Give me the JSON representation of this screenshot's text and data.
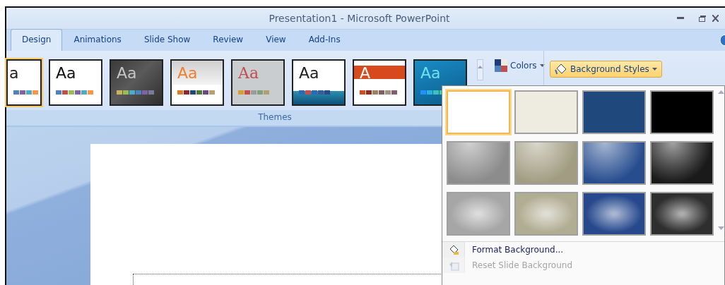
{
  "window": {
    "title": "Presentation1 - Microsoft PowerPoint"
  },
  "tabs": [
    {
      "label": "Design",
      "selected": true
    },
    {
      "label": "Animations",
      "selected": false
    },
    {
      "label": "Slide Show",
      "selected": false
    },
    {
      "label": "Review",
      "selected": false
    },
    {
      "label": "View",
      "selected": false
    },
    {
      "label": "Add-Ins",
      "selected": false
    }
  ],
  "themes": {
    "label": "Themes",
    "items": [
      {
        "kind": "office",
        "text": "a",
        "selected": true
      },
      {
        "kind": "plain",
        "text": "Aa",
        "selected": false
      },
      {
        "kind": "dark",
        "text": "Aa",
        "selected": false
      },
      {
        "kind": "orange",
        "text": "Aa",
        "selected": false
      },
      {
        "kind": "paper",
        "text": "Aa",
        "selected": false
      },
      {
        "kind": "wave",
        "text": "Aa",
        "selected": false
      },
      {
        "kind": "band",
        "text": "A",
        "selected": false
      },
      {
        "kind": "teal",
        "text": "Aa",
        "selected": false
      }
    ]
  },
  "colors_button": {
    "label": "Colors"
  },
  "background_styles_button": {
    "label": "Background Styles",
    "expanded": true
  },
  "background_styles": [
    {
      "kind": "solid",
      "color": "#ffffff",
      "selected": true
    },
    {
      "kind": "solid",
      "color": "#eeece1",
      "selected": false
    },
    {
      "kind": "solid",
      "color": "#1f497d",
      "selected": false
    },
    {
      "kind": "solid",
      "color": "#000000",
      "selected": false
    },
    {
      "kind": "gradient",
      "color": "#8c8c8c",
      "selected": false
    },
    {
      "kind": "gradient",
      "color": "#a29d82",
      "selected": false
    },
    {
      "kind": "gradient",
      "color": "#284d8f",
      "selected": false
    },
    {
      "kind": "gradient",
      "color": "#1a1a1a",
      "selected": false
    },
    {
      "kind": "radial",
      "color": "#a6a6a6",
      "selected": false
    },
    {
      "kind": "radial",
      "color": "#b1ad93",
      "selected": false
    },
    {
      "kind": "radial",
      "color": "#27488c",
      "selected": false
    },
    {
      "kind": "radial",
      "color": "#2e2e2e",
      "selected": false
    }
  ],
  "menu": [
    {
      "label": "Format Background...",
      "disabled": false
    },
    {
      "label": "Reset Slide Background",
      "disabled": true
    }
  ]
}
